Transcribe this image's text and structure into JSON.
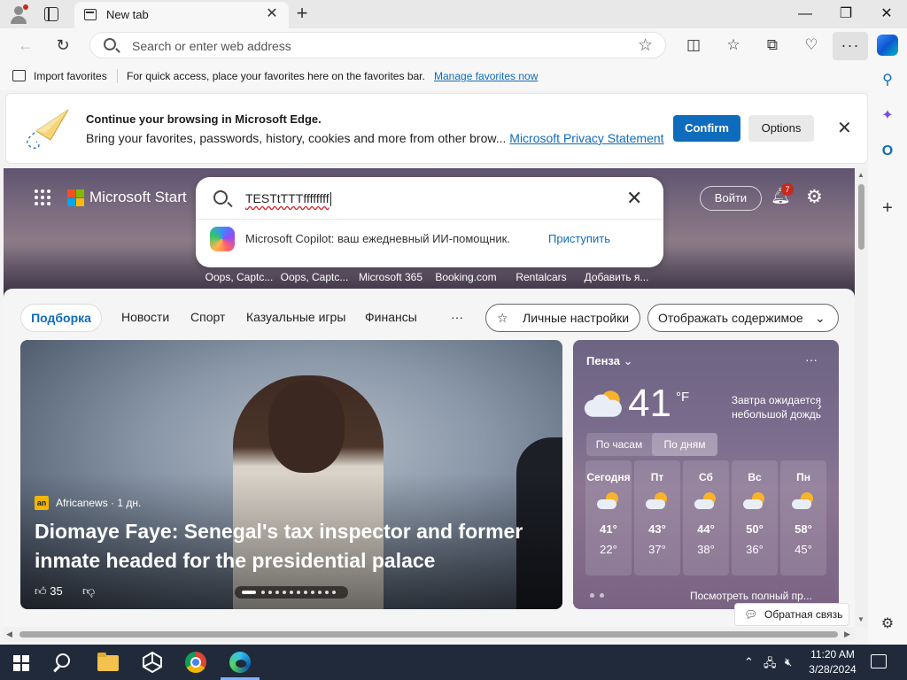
{
  "browser": {
    "tab_title": "New tab",
    "address_placeholder": "Search or enter web address"
  },
  "favorites_bar": {
    "import_label": "Import favorites",
    "info_text": "For quick access, place your favorites here on the favorites bar.",
    "manage_link": "Manage favorites now"
  },
  "banner": {
    "title": "Continue your browsing in Microsoft Edge.",
    "body": "Bring your favorites, passwords, history, cookies and more from other brow...",
    "privacy_link": "Microsoft Privacy Statement",
    "confirm_label": "Confirm",
    "options_label": "Options"
  },
  "start": {
    "brand": "Microsoft Start",
    "search_query": "TESTtTTTffffffff",
    "suggestion_text": "Microsoft Copilot: ваш ежедневный ИИ-помощник.",
    "suggestion_link": "Приступить",
    "login_label": "Войти",
    "notif_count": "7",
    "quick_links": [
      "Oops, Captc...",
      "Oops, Captc...",
      "Microsoft 365",
      "Booking.com",
      "Rentalcars",
      "Добавить я..."
    ]
  },
  "feed": {
    "nav": [
      "Подборка",
      "Новости",
      "Спорт",
      "Казуальные игры",
      "Финансы",
      "···"
    ],
    "personalize_label": "Личные настройки",
    "display_label": "Отображать содержимое",
    "article": {
      "source_logo": "an",
      "source": "Africanews · 1 дн.",
      "headline": "Diomaye Faye: Senegal's tax inspector and former inmate headed for the presidential palace",
      "likes": "35"
    },
    "feedback_label": "Обратная связь"
  },
  "weather": {
    "city": "Пенза",
    "temp": "41",
    "unit": "°F",
    "note": "Завтра ожидается небольшой дождь",
    "tab_hourly": "По часам",
    "tab_daily": "По дням",
    "days": [
      {
        "day": "Сегодня",
        "hi": "41°",
        "lo": "22°"
      },
      {
        "day": "Пт",
        "hi": "43°",
        "lo": "37°"
      },
      {
        "day": "Сб",
        "hi": "44°",
        "lo": "38°"
      },
      {
        "day": "Вс",
        "hi": "50°",
        "lo": "36°"
      },
      {
        "day": "Пн",
        "hi": "58°",
        "lo": "45°"
      }
    ],
    "footer_link": "Посмотреть полный пр..."
  },
  "taskbar": {
    "time": "11:20 AM",
    "date": "3/28/2024"
  },
  "colors": {
    "accent": "#0f6cbd",
    "taskbar": "#202a3a",
    "badge": "#c42b1c"
  }
}
